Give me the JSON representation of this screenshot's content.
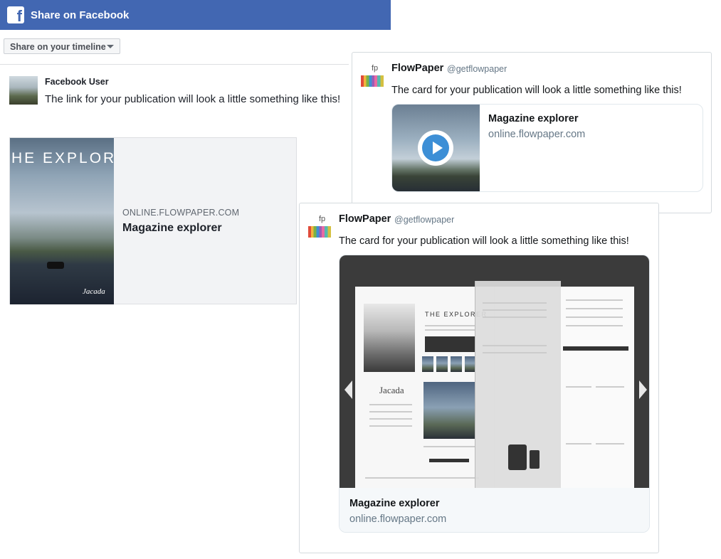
{
  "facebook": {
    "header_title": "Share on Facebook",
    "share_select": "Share on your timeline",
    "user_name": "Facebook User",
    "message": "The link for your publication will look a little something like this!",
    "card": {
      "cover_title": "HE EXPLORER",
      "cover_brand": "Jacada",
      "domain": "ONLINE.FLOWPAPER.COM",
      "title": "Magazine explorer"
    },
    "brand_color": "#4267b2"
  },
  "twitter_summary": {
    "name": "FlowPaper",
    "handle": "@getflowpaper",
    "text": "The card for your publication will look a little something like this!",
    "card_title": "Magazine explorer",
    "card_domain": "online.flowpaper.com",
    "icon": "play-icon"
  },
  "twitter_player": {
    "name": "FlowPaper",
    "handle": "@getflowpaper",
    "text": "The card for your publication will look a little something like this!",
    "magazine_heading": "THE EXPLORER",
    "magazine_brand": "Jacada",
    "card_title": "Magazine explorer",
    "card_domain": "online.flowpaper.com"
  },
  "avatar_label": "fp"
}
